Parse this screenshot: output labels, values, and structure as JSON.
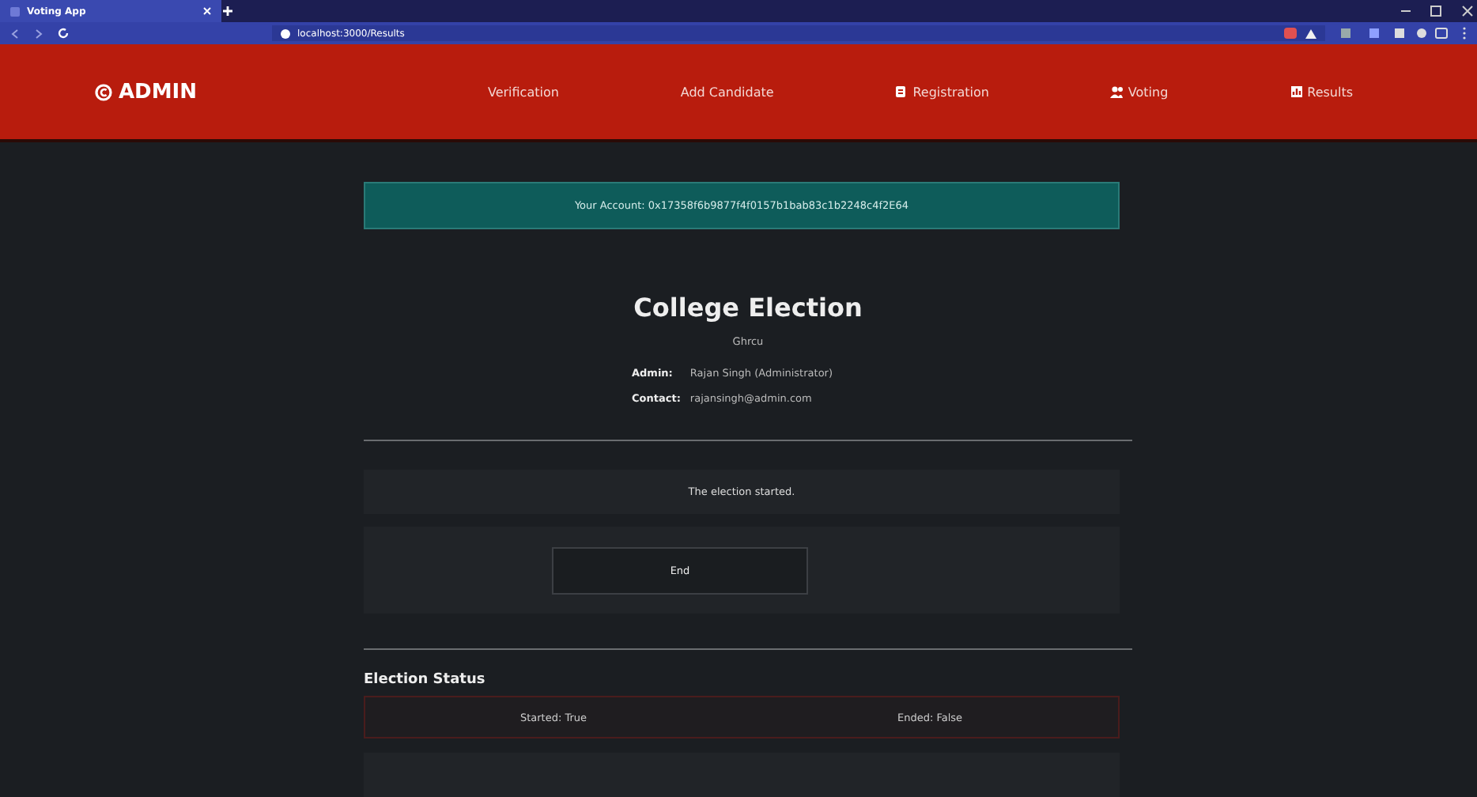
{
  "browser": {
    "tab_title": "Voting App",
    "url": "localhost:3000/Results"
  },
  "navbar": {
    "brand": "ADMIN",
    "links": [
      {
        "label": "Verification"
      },
      {
        "label": "Add Candidate"
      },
      {
        "label": "Registration"
      },
      {
        "label": "Voting"
      },
      {
        "label": "Results"
      }
    ]
  },
  "account": "Your Account: 0x17358f6b9877f4f0157b1bab83c1b2248c4f2E64",
  "election": {
    "title": "College Election",
    "organization": "Ghrcu",
    "details": [
      {
        "label": "Admin:",
        "value": "Rajan Singh (Administrator)"
      },
      {
        "label": "Contact:",
        "value": "rajansingh@admin.com"
      }
    ]
  },
  "notice": "The election started.",
  "end_button": "End",
  "status": {
    "heading": "Election Status",
    "items": [
      "Started: True",
      "Ended: False"
    ]
  }
}
